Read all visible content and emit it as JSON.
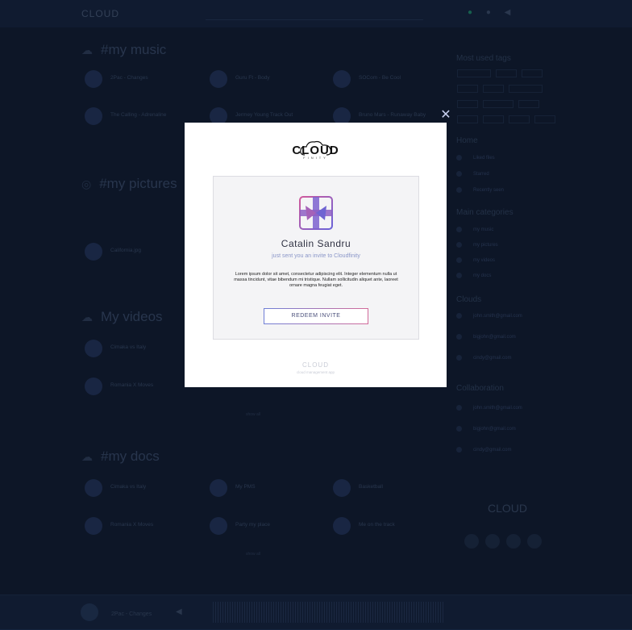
{
  "app": {
    "logo": "CLOUD"
  },
  "header": {
    "search_placeholder": ""
  },
  "sections": {
    "music": {
      "title": "#my music",
      "items": [
        "2Pac - Changes",
        "Guru Ft - Body",
        "SOCom - Be Cool",
        "The Calling - Adrenaline",
        "Jermey Young Track Out",
        "Bruno Mars - Runaway Baby"
      ]
    },
    "pictures": {
      "title": "#my pictures",
      "items": [
        "California.jpg"
      ]
    },
    "videos": {
      "title": "My videos",
      "items": [
        "Cimaka vs Italy",
        "Romania X Moves"
      ],
      "show_all": "show all"
    },
    "docs": {
      "title": "#my docs",
      "items": [
        "Cimaka vs Italy",
        "My PMS",
        "Basketball",
        "Romania X Moves",
        "Party my place",
        "Me on the track"
      ],
      "show_all": "show all"
    }
  },
  "sidebar": {
    "tags_title": "Most used tags",
    "home_title": "Home",
    "home_items": [
      "Liked files",
      "Starred",
      "Recently seen"
    ],
    "categories_title": "Main categories",
    "categories": [
      "my music",
      "my pictures",
      "my videos",
      "my docs"
    ],
    "clouds_title": "Clouds",
    "clouds": [
      "john.smith@gmail.com",
      "bigjohn@gmail.com",
      "cindy@gmail.com"
    ],
    "collab_title": "Collaboration",
    "collab": [
      "john.smith@gmail.com",
      "bigjohn@gmail.com",
      "cindy@gmail.com"
    ],
    "footer_logo": "CLOUD"
  },
  "player": {
    "track": "2Pac - Changes"
  },
  "modal": {
    "logo_word": "CLOUD",
    "logo_sub": "FINITY",
    "name": "Catalin Sandru",
    "subtitle": "just sent you an invite to Cloudfinity",
    "body": "Lorem ipsum dolor sit amet, consectetur adipiscing elit. Integer elementum nulla ut massa tincidunt, vitae bibendum mi tristique. Nullam sollicitudin aliquet ante, laoreet ornare magna feugiat eget.",
    "button": "REDEEM INVITE",
    "footer_logo": "CLOUD",
    "footer_tag": "cloud management app",
    "close": "✕"
  },
  "colors": {
    "accent_start": "#6f7fd6",
    "accent_end": "#d26b9a",
    "background": "#101b2e"
  }
}
